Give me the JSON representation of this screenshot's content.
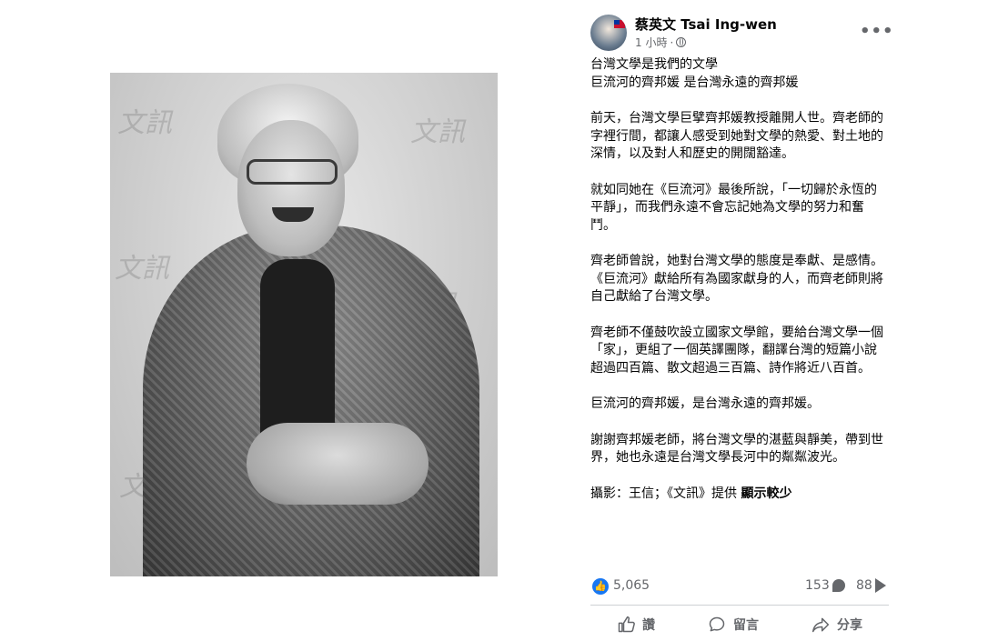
{
  "post": {
    "author": "蔡英文 Tsai Ing-wen",
    "time": "1 小時",
    "separator": "·",
    "more_label": "•••",
    "paragraphs": [
      "台灣文學是我們的文學",
      "巨流河的齊邦媛 是台灣永遠的齊邦媛",
      "前天，台灣文學巨擘齊邦媛教授離開人世。齊老師的字裡行間，都讓人感受到她對文學的熱愛、對土地的深情，以及對人和歷史的開闊豁達。",
      "就如同她在《巨流河》最後所說，「一切歸於永恆的平靜」，而我們永遠不會忘記她為文學的努力和奮鬥。",
      "齊老師曾說，她對台灣文學的態度是奉獻、是感情。《巨流河》獻給所有為國家獻身的人，而齊老師則將自己獻給了台灣文學。",
      "齊老師不僅鼓吹設立國家文學館，要給台灣文學一個「家」，更組了一個英譯團隊，翻譯台灣的短篇小說超過四百篇、散文超過三百篇、詩作將近八百首。",
      "巨流河的齊邦媛，是台灣永遠的齊邦媛。",
      "謝謝齊邦媛老師，將台灣文學的湛藍與靜美，帶到世界，她也永遠是台灣文學長河中的粼粼波光。"
    ],
    "credit": "攝影：王信；《文訊》提供",
    "see_more": "顯示較少"
  },
  "stats": {
    "likes": "5,065",
    "comments": "153",
    "shares": "88"
  },
  "actions": {
    "like": "讚",
    "comment": "留言",
    "share": "分享"
  },
  "photo": {
    "watermark": "文訊"
  }
}
